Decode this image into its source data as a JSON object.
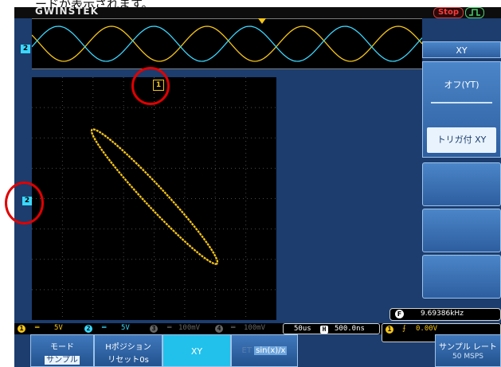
{
  "caption": "ードが表示されます。",
  "header": {
    "brand": "GWINSTEK",
    "run_status": "Stop",
    "trigger_icon": "trigger-edge-icon"
  },
  "channel_markers": {
    "ch1": "1",
    "ch2_window": "2",
    "ch2": "2"
  },
  "menu": {
    "title": "XY",
    "option_off": "オフ(YT)",
    "option_on": "トリガ付 XY"
  },
  "frequency": "9.69386kHz",
  "frequency_prefix": "F",
  "status": {
    "ch1_num": "1",
    "ch1_scale": "5V",
    "ch2_num": "2",
    "ch2_scale": "5V",
    "ch3_num": "3",
    "ch3_scale": "100mV",
    "ch4_num": "4",
    "ch4_scale": "100mV",
    "timebase": "50us",
    "h_prefix": "H",
    "h_position": "500.0ns",
    "trig_ch": "1",
    "trig_level": "0.00V"
  },
  "softkeys": {
    "mode_label": "モード",
    "mode_value": "サンプル",
    "hpos_label": "Hポジション",
    "hpos_value": "リセット0s",
    "xy_label": "XY",
    "sinx_prefix": "ET",
    "sinx_label": "sin(x)/x",
    "rate_label": "サンプル レート",
    "rate_value": "50 MSPS"
  },
  "colors": {
    "ch1": "#f5c518",
    "ch2": "#3ad8ff",
    "background": "#1c3d6e"
  }
}
